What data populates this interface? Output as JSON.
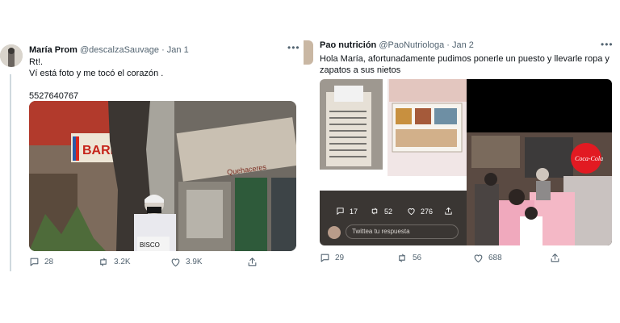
{
  "tweet1": {
    "author_name": "María Prom",
    "handle": "@descalzaSauvage",
    "date": "· Jan 1",
    "line1": "Rt!.",
    "line2": "Ví está foto y me tocó el corazón .",
    "phone": "5527640767",
    "photo_signs": {
      "barber": "BARI",
      "awning": "Quehaceres",
      "card": "BISCO"
    },
    "reply_count": "28",
    "retweet_count": "3.2K",
    "like_count": "3.9K"
  },
  "tweet2": {
    "author_name": "Pao nutrición",
    "handle": "@PaoNutriologa",
    "date": "· Jan 2",
    "text_line1": "Hola María, afortunadamente pudimos ponerle un puesto y llevarle ropa y",
    "text_line2": "zapatos a sus nietos",
    "embedded": {
      "reply_count": "17",
      "retweet_count": "52",
      "like_count": "276",
      "reply_placeholder": "Twittea tu respuesta"
    },
    "coca_cola_text": "Coca-Cola",
    "reply_count": "29",
    "retweet_count": "56",
    "like_count": "688"
  },
  "colors": {
    "link_gray": "#536471",
    "divider": "#cfd9de",
    "coca_red": "#e21a22"
  }
}
